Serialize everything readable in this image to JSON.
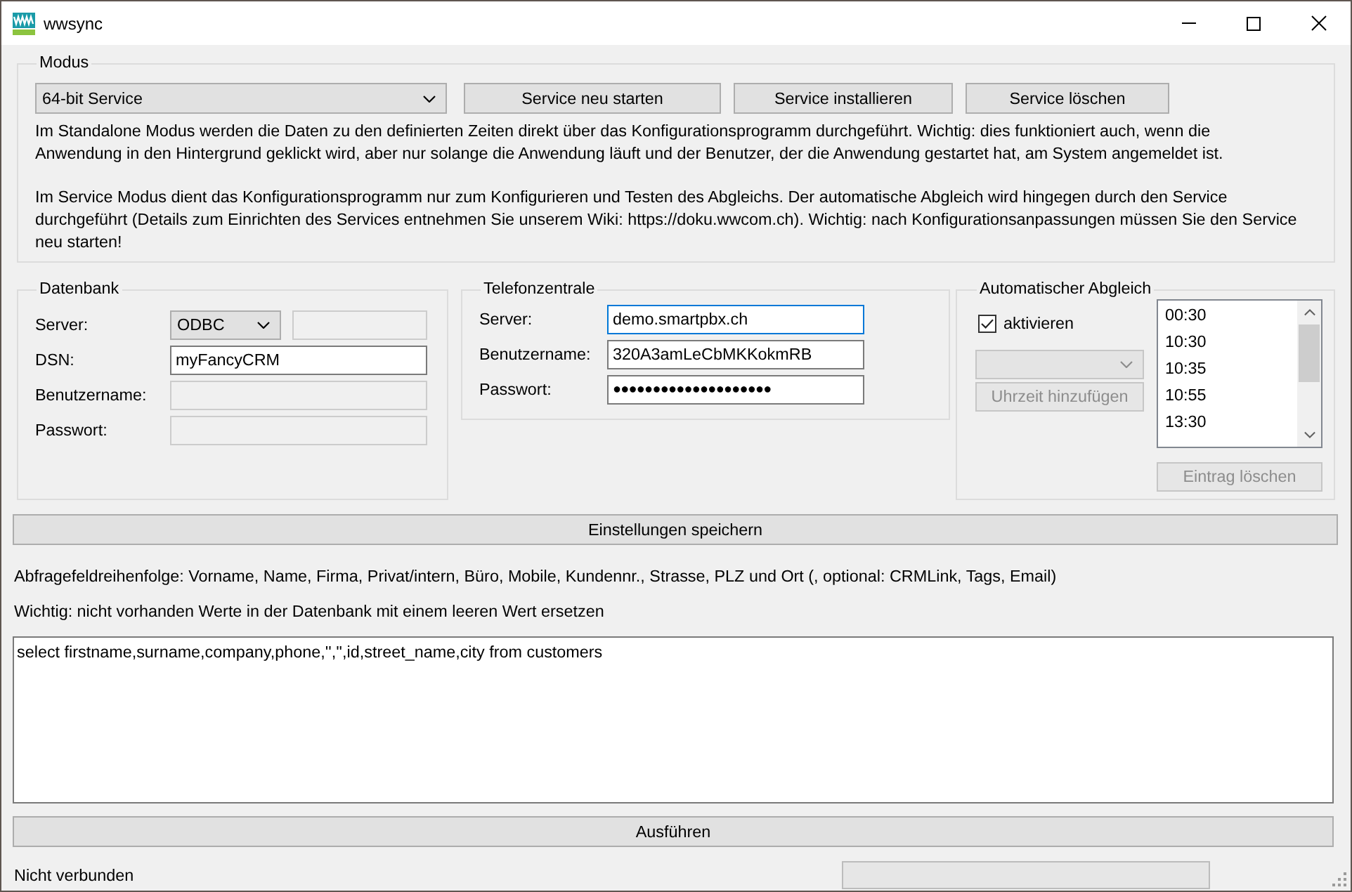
{
  "window": {
    "title": "wwsync"
  },
  "mode": {
    "legend": "Modus",
    "select": {
      "value": "64-bit Service"
    },
    "buttons": [
      {
        "label": "Service neu starten",
        "disabled": false
      },
      {
        "label": "Service installieren",
        "disabled": false
      },
      {
        "label": "Service löschen",
        "disabled": false
      }
    ],
    "paragraphs": [
      "Im Standalone Modus werden die Daten zu den definierten Zeiten direkt über das Konfigurationsprogramm durchgeführt. Wichtig: dies funktioniert auch, wenn die Anwendung in den Hintergrund geklickt wird, aber nur solange die Anwendung läuft und der Benutzer, der die Anwendung gestartet hat, am System angemeldet ist.",
      "Im Service Modus dient das Konfigurationsprogramm nur zum Konfigurieren und Testen des Abgleichs. Der automatische Abgleich wird hingegen durch den Service durchgeführt (Details zum Einrichten des Services entnehmen Sie unserem Wiki: https://doku.wwcom.ch). Wichtig: nach Konfigurationsanpassungen müssen Sie den Service neu starten!"
    ]
  },
  "database": {
    "legend": "Datenbank",
    "rows": [
      {
        "kind": "select_text",
        "label": "Server:",
        "select": {
          "value": "ODBC",
          "disabled": false
        },
        "field": {
          "disabled": true
        }
      },
      {
        "kind": "text",
        "label": "DSN:",
        "field": {
          "value": "myFancyCRM",
          "disabled": false
        }
      },
      {
        "kind": "text",
        "label": "Benutzername:",
        "field": {
          "disabled": true
        }
      },
      {
        "kind": "text",
        "label": "Passwort:",
        "field": {
          "disabled": true
        }
      }
    ]
  },
  "pbx": {
    "legend": "Telefonzentrale",
    "rows": [
      {
        "kind": "text",
        "label": "Server:",
        "field": {
          "value": "demo.smartpbx.ch",
          "focused": true
        }
      },
      {
        "kind": "text",
        "label": "Benutzername:",
        "field": {
          "value": "320A3amLeCbMKKokmRB",
          "focused": false
        }
      },
      {
        "kind": "password",
        "label": "Passwort:",
        "field": {
          "value": "●●●●●●●●●●●●●●●●●●●●",
          "focused": false
        }
      }
    ]
  },
  "auto_sync": {
    "legend": "Automatischer Abgleich",
    "activate": {
      "label": "aktivieren",
      "checked": true
    },
    "time_select": {
      "disabled": true
    },
    "add_button": {
      "label": "Uhrzeit hinzufügen",
      "disabled": true
    },
    "times": [
      {
        "label": "00:30",
        "selected": false
      },
      {
        "label": "10:30",
        "selected": false
      },
      {
        "label": "10:35",
        "selected": false
      },
      {
        "label": "10:55",
        "selected": false
      },
      {
        "label": "13:30",
        "selected": false
      }
    ],
    "delete_button": {
      "label": "Eintrag löschen",
      "disabled": true
    }
  },
  "save_button": {
    "label": "Einstellungen speichern",
    "disabled": false
  },
  "notes": [
    "Abfragefeldreihenfolge: Vorname, Name, Firma, Privat/intern, Büro, Mobile, Kundennr., Strasse, PLZ und Ort (, optional: CRMLink, Tags, Email)",
    "Wichtig: nicht vorhanden Werte in der Datenbank mit einem leeren Wert ersetzen"
  ],
  "query": {
    "value": "select firstname,surname,company,phone,'','',id,street_name,city from customers"
  },
  "run_button": {
    "label": "Ausführen",
    "disabled": false
  },
  "status_bar": {
    "text": "Nicht verbunden",
    "progress": {
      "level": 0
    }
  }
}
